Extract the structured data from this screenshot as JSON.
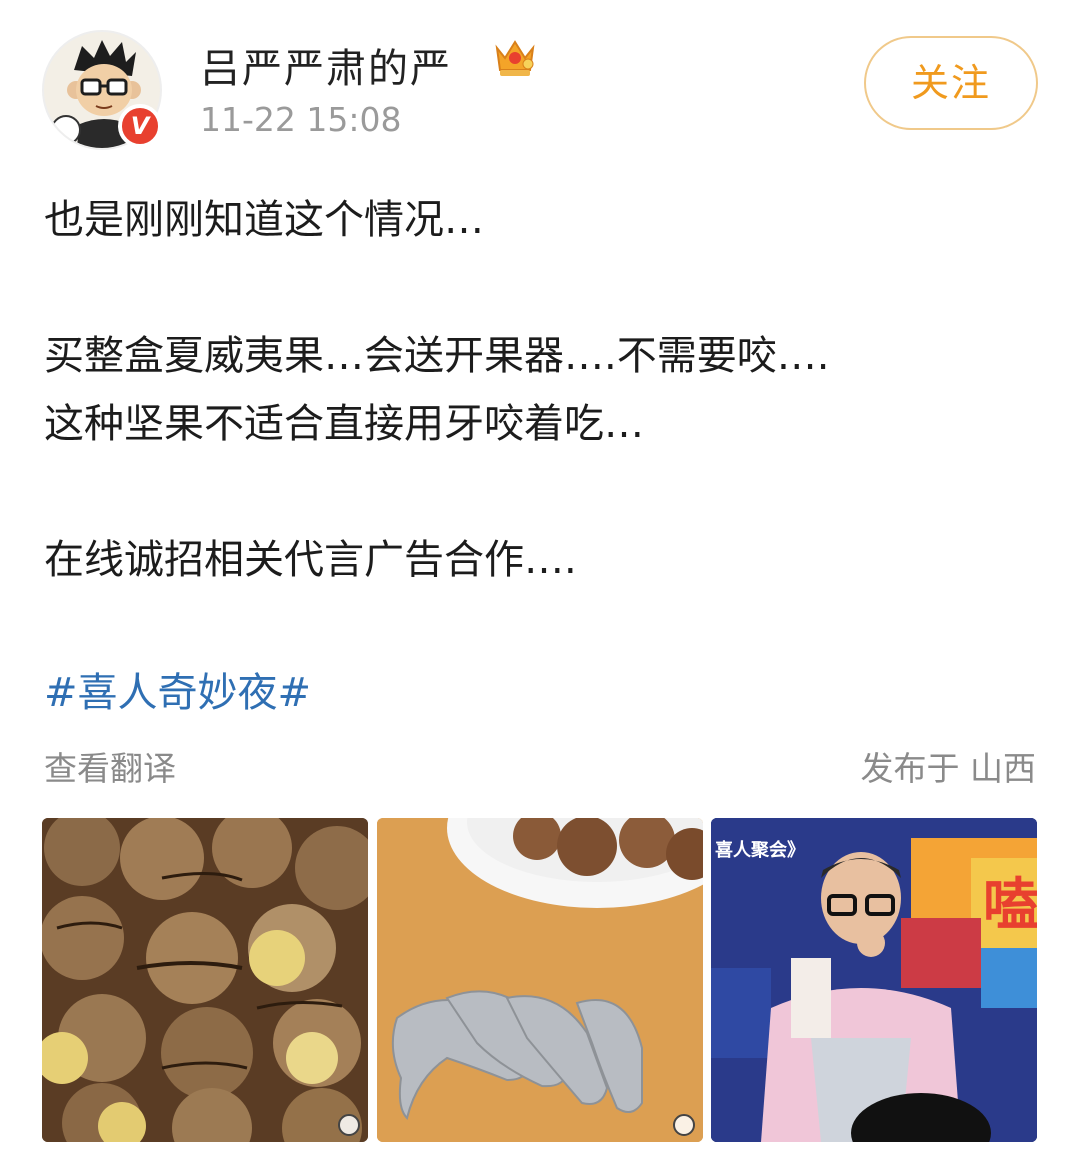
{
  "user": {
    "name": "吕严严肃的严",
    "time": "11-22 15:08",
    "verified_badge": "V",
    "follow_label": "关注"
  },
  "post": {
    "paragraphs": [
      "也是刚刚知道这个情况…",
      "买整盒夏威夷果…会送开果器….不需要咬….",
      "这种坚果不适合直接用牙咬着吃…",
      "在线诚招相关代言广告合作…."
    ],
    "hashtag": "#喜人奇妙夜#",
    "translate_label": "查看翻译",
    "location_label": "发布于 山西"
  },
  "images": [
    {
      "name": "macadamia-nuts-photo"
    },
    {
      "name": "nut-opener-tools-photo"
    },
    {
      "name": "tv-show-eating-photo",
      "caption": "喜人聚会》",
      "overlay_char": "嗑"
    }
  ],
  "colors": {
    "accent": "#f09a1e",
    "link": "#2f6fb3",
    "muted": "#9a9a9a",
    "badge": "#e8402f"
  }
}
